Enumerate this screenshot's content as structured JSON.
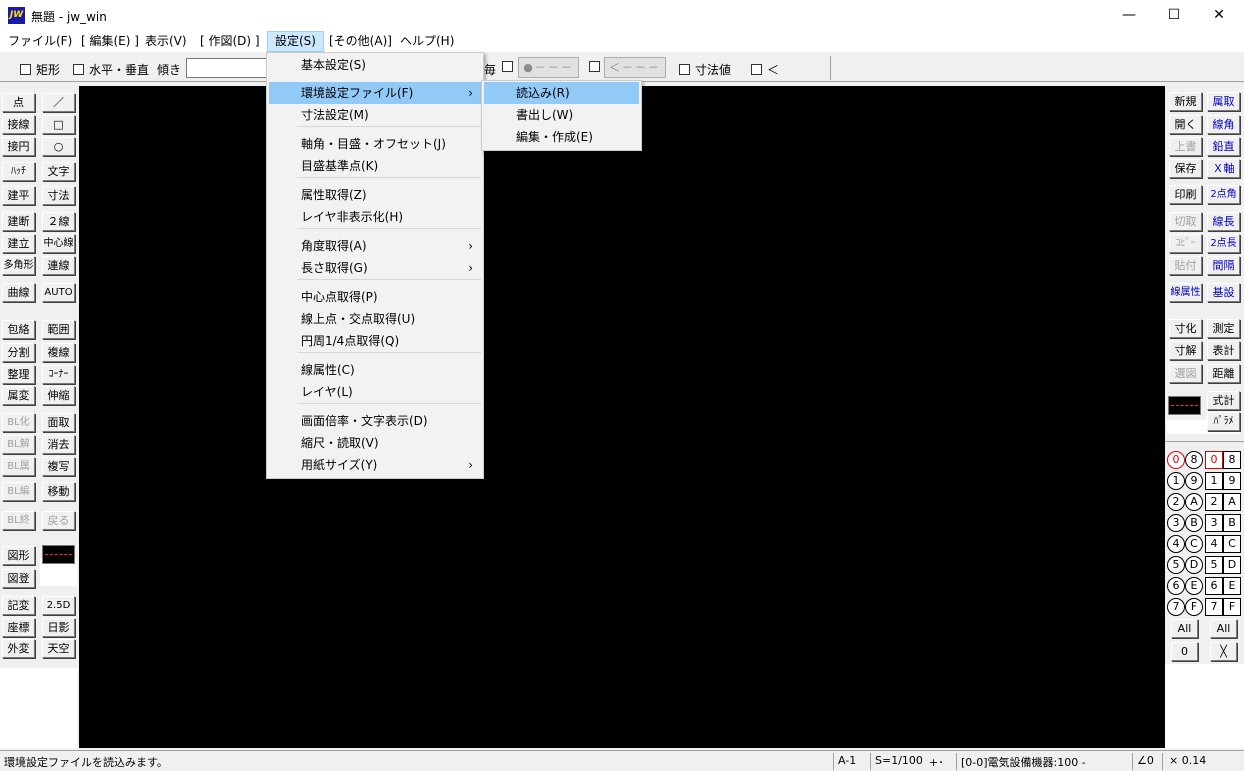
{
  "window": {
    "title": "無題 - jw_win",
    "icon_text": "JW",
    "minimize": "—",
    "maximize": "☐",
    "close": "✕"
  },
  "menubar": [
    {
      "label": "ファイル(F)"
    },
    {
      "label": "[ 編集(E) ]"
    },
    {
      "label": "表示(V)"
    },
    {
      "label": "[ 作図(D) ]"
    },
    {
      "label": "設定(S)"
    },
    {
      "label": "[その他(A)]"
    },
    {
      "label": "ヘルプ(H)"
    }
  ],
  "toolbar": {
    "rect": "矩形",
    "horiz_vert": "水平・垂直",
    "angle": "傾き",
    "each": "毎",
    "btn1": "●－－－",
    "btn2": "＜－－－－",
    "dim_value": "寸法値",
    "lt": "＜"
  },
  "left_tools": [
    [
      "点",
      "／"
    ],
    [
      "接線",
      "□"
    ],
    [
      "接円",
      "○"
    ],
    [
      "ﾊｯﾁ",
      "文字"
    ],
    [
      "建平",
      "寸法"
    ],
    [
      "建断",
      "２線"
    ],
    [
      "建立",
      "中心線"
    ],
    [
      "多角形",
      "連線"
    ],
    [
      "曲線",
      "AUTO"
    ],
    [
      "包絡",
      "範囲"
    ],
    [
      "分割",
      "複線"
    ],
    [
      "整理",
      "ｺｰﾅｰ"
    ],
    [
      "属変",
      "伸縮"
    ],
    [
      "BL化",
      "面取"
    ],
    [
      "BL解",
      "消去"
    ],
    [
      "BL属",
      "複写"
    ],
    [
      "BL編",
      "移動"
    ],
    [
      "BL終",
      "戻る"
    ],
    [
      "図形",
      ""
    ],
    [
      "図登",
      ""
    ],
    [
      "記変",
      "2.5D"
    ],
    [
      "座標",
      "日影"
    ],
    [
      "外変",
      "天空"
    ]
  ],
  "right_tools": [
    [
      "新規",
      "属取"
    ],
    [
      "開く",
      "線角"
    ],
    [
      "上書",
      "鉛直"
    ],
    [
      "保存",
      "Ｘ軸"
    ],
    [
      "印刷",
      "2点角"
    ],
    [
      "切取",
      "線長"
    ],
    [
      "ｺﾋﾟｰ",
      "2点長"
    ],
    [
      "貼付",
      "間隔"
    ],
    [
      "線属性",
      "基設"
    ],
    [
      "寸化",
      "測定"
    ],
    [
      "寸解",
      "表計"
    ],
    [
      "選図",
      "距離"
    ],
    [
      "",
      "式計"
    ],
    [
      "",
      "ﾊﾟﾗﾒ"
    ]
  ],
  "layer_groups": {
    "circles_left": [
      "0",
      "1",
      "2",
      "3",
      "4",
      "5",
      "6",
      "7"
    ],
    "circles_right": [
      "8",
      "9",
      "A",
      "B",
      "C",
      "D",
      "E",
      "F"
    ],
    "squares_left": [
      "0",
      "1",
      "2",
      "3",
      "4",
      "5",
      "6",
      "7"
    ],
    "squares_right": [
      "8",
      "9",
      "A",
      "B",
      "C",
      "D",
      "E",
      "F"
    ],
    "all_left": "All",
    "all_right": "All",
    "zero_left": "0",
    "x_right": "╳"
  },
  "settings_menu": {
    "items": [
      {
        "label": "基本設定(S)"
      },
      {
        "label": "環境設定ファイル(F)",
        "submenu": true
      },
      {
        "label": "寸法設定(M)"
      },
      {
        "label": "軸角・目盛・オフセット(J)"
      },
      {
        "label": "目盛基準点(K)"
      },
      {
        "label": "属性取得(Z)"
      },
      {
        "label": "レイヤ非表示化(H)"
      },
      {
        "label": "角度取得(A)",
        "submenu": true
      },
      {
        "label": "長さ取得(G)",
        "submenu": true
      },
      {
        "label": "中心点取得(P)"
      },
      {
        "label": "線上点・交点取得(U)"
      },
      {
        "label": "円周1/4点取得(Q)"
      },
      {
        "label": "線属性(C)"
      },
      {
        "label": "レイヤ(L)"
      },
      {
        "label": "画面倍率・文字表示(D)"
      },
      {
        "label": "縮尺・読取(V)"
      },
      {
        "label": "用紙サイズ(Y)",
        "submenu": true
      }
    ],
    "arrow": "›"
  },
  "env_submenu": {
    "items": [
      {
        "label": "読込み(R)"
      },
      {
        "label": "書出し(W)"
      },
      {
        "label": "編集・作成(E)"
      }
    ]
  },
  "statusbar": {
    "message": "環境設定ファイルを読込みます。",
    "paper": "A-1",
    "scale": "S=1/100",
    "snap": "+･",
    "layer": "[0-0]電気設備機器:100 -",
    "angle": "∠0",
    "zoom": "× 0.14"
  }
}
